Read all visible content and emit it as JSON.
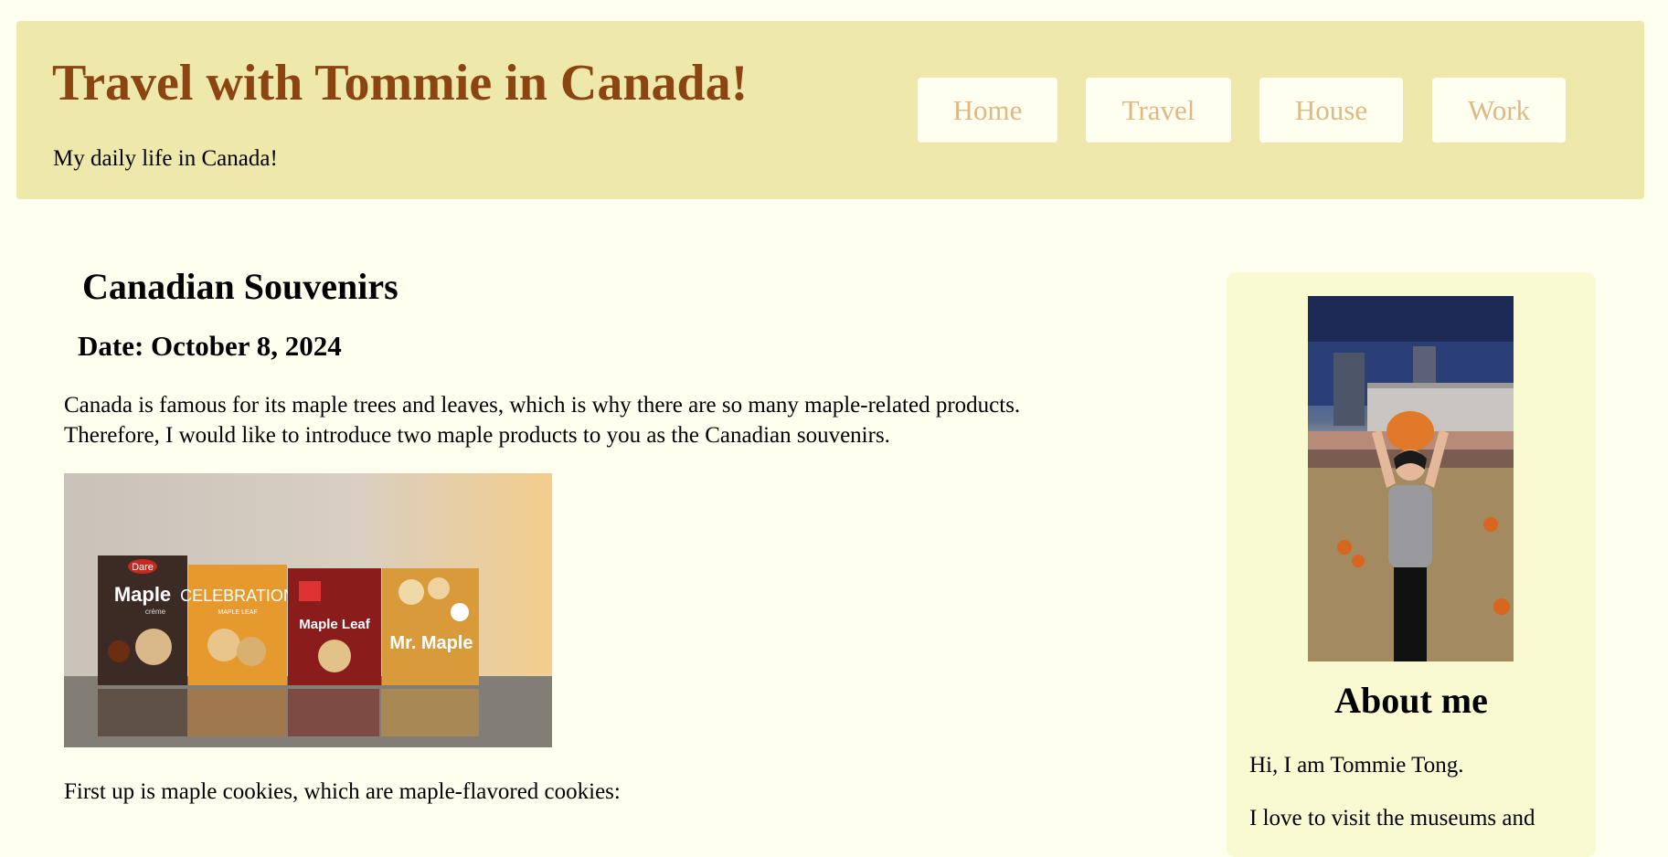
{
  "header": {
    "title": "Travel with Tommie in Canada!",
    "tagline": "My daily life in Canada!",
    "nav": [
      {
        "label": "Home"
      },
      {
        "label": "Travel"
      },
      {
        "label": "House"
      },
      {
        "label": "Work"
      }
    ]
  },
  "post": {
    "title": "Canadian Souvenirs",
    "date": "Date: October 8, 2024",
    "intro_line1": "Canada is famous for its maple trees and leaves, which is why there are so many maple-related products.",
    "intro_line2": "Therefore, I would like to introduce two maple products to you as the Canadian souvenirs.",
    "photo": {
      "boxes": [
        {
          "brand": "Dare",
          "name": "Maple",
          "sub": "crème"
        },
        {
          "brand": "",
          "name": "CELEBRATION",
          "sub": "MAPLE LEAF"
        },
        {
          "brand": "",
          "name": "Maple Leaf",
          "sub": ""
        },
        {
          "brand": "",
          "name": "Mr. Maple",
          "sub": ""
        }
      ]
    },
    "first_paragraph": "First up is maple cookies, which are maple-flavored cookies:"
  },
  "aside": {
    "about_title": "About me",
    "p1": "Hi, I am Tommie Tong.",
    "p2": "I love to visit the museums and"
  },
  "colors": {
    "page_bg": "#fffff0",
    "header_bg": "#eee8aa",
    "title_color": "#8b4513",
    "nav_text": "#deb887",
    "aside_bg": "#fafad2"
  }
}
